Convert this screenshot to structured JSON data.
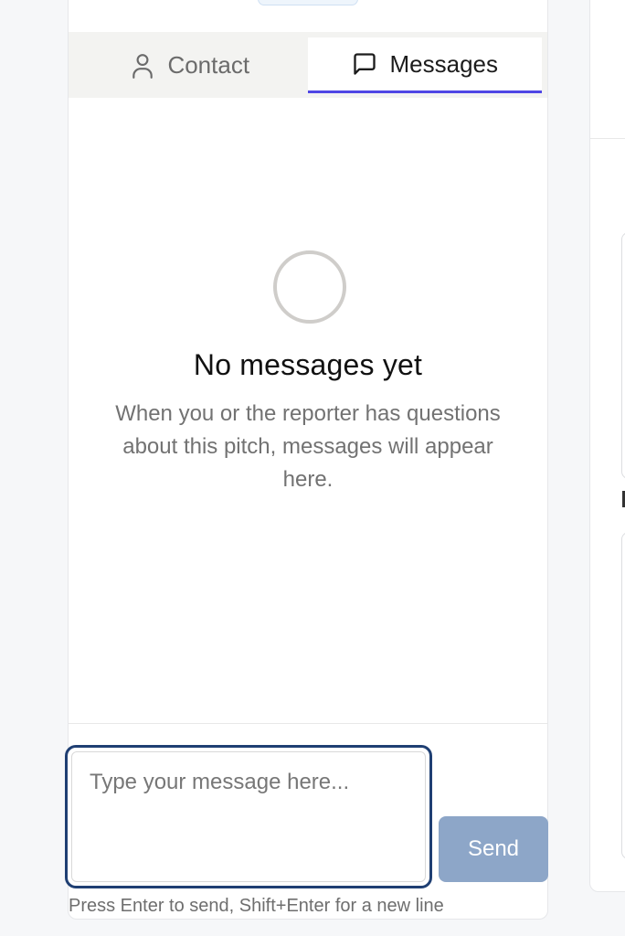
{
  "tabs": [
    {
      "label": "Contact",
      "icon": "user-icon",
      "active": false
    },
    {
      "label": "Messages",
      "icon": "message-square-icon",
      "active": true
    }
  ],
  "empty_state": {
    "title": "No messages yet",
    "description": "When you or the reporter has questions about this pitch, messages will appear here."
  },
  "composer": {
    "value": "",
    "placeholder": "Type your message here...",
    "send_label": "Send",
    "hint": "Press Enter to send, Shift+Enter for a new line"
  },
  "colors": {
    "accent": "#4f46e5",
    "input_focus_border": "#1f3f73",
    "send_button_disabled": "#8da6c8"
  }
}
